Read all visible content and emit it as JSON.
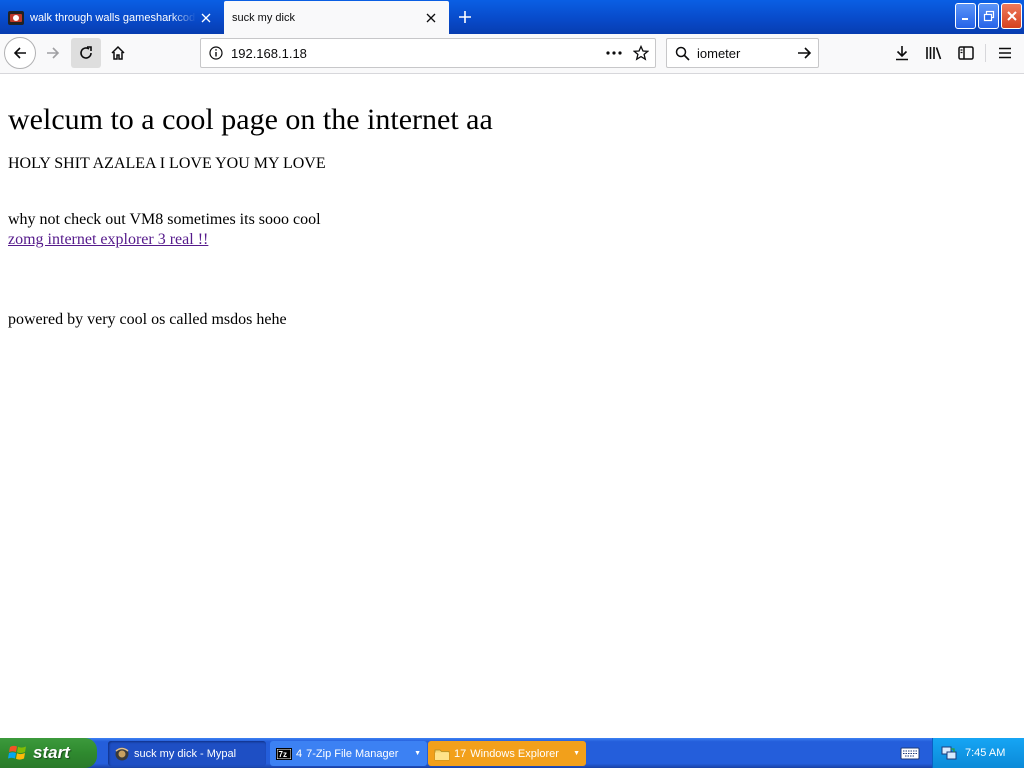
{
  "browser": {
    "tabs": [
      {
        "title": "walk through walls gamesharkcodes"
      },
      {
        "title": "suck my dick"
      }
    ],
    "url": "192.168.1.18",
    "search_value": "iometer"
  },
  "page": {
    "heading": "welcum to a cool page on the internet aa",
    "line1": "HOLY SHIT AZALEA I LOVE YOU MY LOVE",
    "line2": "why not check out VM8 sometimes its sooo cool",
    "link": "zomg internet explorer 3 real !!",
    "line3": "powered by very cool os called msdos hehe"
  },
  "taskbar": {
    "start_label": "start",
    "tasks": [
      {
        "count": "",
        "label": "suck my dick - Mypal"
      },
      {
        "count": "4",
        "label": "7-Zip File Manager"
      },
      {
        "count": "17",
        "label": "Windows Explorer"
      }
    ],
    "clock": "7:45 AM"
  },
  "colors": {
    "titlebar_blue": "#0a5fe4",
    "visited_link": "#551a8b",
    "start_green": "#2f8a2f",
    "explorer_task_orange": "#f2a01b"
  }
}
